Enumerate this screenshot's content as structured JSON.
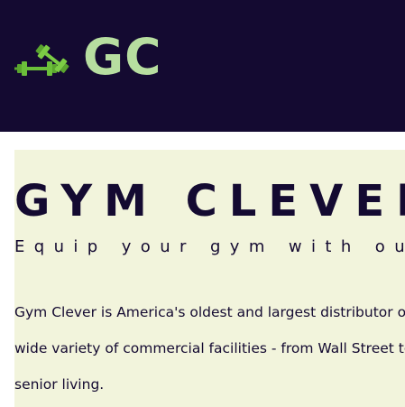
{
  "header": {
    "logo_icon": "dumbbells-icon",
    "logo_text": "GC",
    "colors": {
      "background": "#140a31",
      "logo_text": "#b7dea0",
      "logo_icon": "#6bbf3a"
    }
  },
  "hero": {
    "title": "GYM CLEVER",
    "tagline": "Equip your gym with our w",
    "body_lines": [
      "Gym Clever is America's oldest and largest distributor of fit",
      "wide variety of commercial facilities - from Wall Street to M",
      "senior living."
    ],
    "colors": {
      "background": "#f2f4dc",
      "text": "#140a31"
    }
  }
}
